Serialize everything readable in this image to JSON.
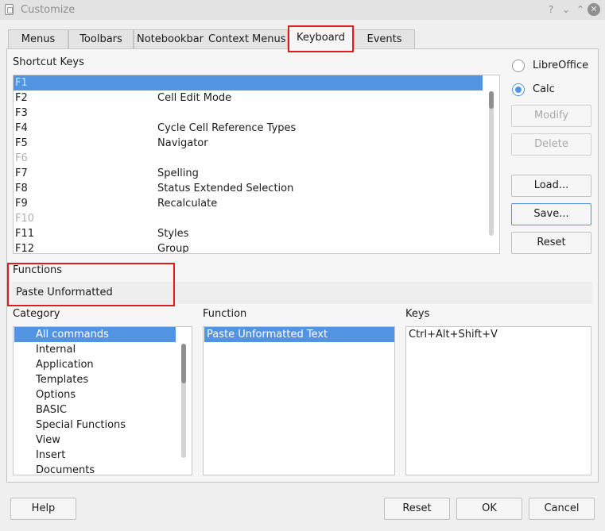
{
  "window": {
    "title": "Customize",
    "controls": [
      "?",
      "⌄",
      "⌃",
      "✕"
    ]
  },
  "tabs": [
    {
      "label": "Menus"
    },
    {
      "label": "Toolbars"
    },
    {
      "label": "Notebookbar"
    },
    {
      "label": "Context Menus"
    },
    {
      "label": "Keyboard",
      "active": true
    },
    {
      "label": "Events"
    }
  ],
  "shortcut_keys": {
    "label": "Shortcut Keys",
    "rows": [
      {
        "key": "F1",
        "function": ""
      },
      {
        "key": "F2",
        "function": "Cell Edit Mode"
      },
      {
        "key": "F3",
        "function": ""
      },
      {
        "key": "F4",
        "function": "Cycle Cell Reference Types"
      },
      {
        "key": "F5",
        "function": "Navigator"
      },
      {
        "key": "F6",
        "function": ""
      },
      {
        "key": "F7",
        "function": "Spelling"
      },
      {
        "key": "F8",
        "function": "Status Extended Selection"
      },
      {
        "key": "F9",
        "function": "Recalculate"
      },
      {
        "key": "F10",
        "function": ""
      },
      {
        "key": "F11",
        "function": "Styles"
      },
      {
        "key": "F12",
        "function": "Group"
      }
    ]
  },
  "scope": {
    "options": [
      {
        "label": "LibreOffice",
        "checked": false
      },
      {
        "label": "Calc",
        "checked": true
      }
    ]
  },
  "side_buttons": [
    {
      "label": "Modify",
      "enabled": false
    },
    {
      "label": "Delete",
      "enabled": false
    },
    {
      "label": "Load...",
      "enabled": true
    },
    {
      "label": "Save...",
      "enabled": true
    },
    {
      "label": "Reset",
      "enabled": true
    }
  ],
  "functions_section": {
    "label": "Functions",
    "search_value": "Paste Unformatted"
  },
  "category": {
    "label": "Category",
    "items": [
      "All commands",
      "Internal",
      "Application",
      "Templates",
      "Options",
      "BASIC",
      "Special Functions",
      "View",
      "Insert",
      "Documents"
    ],
    "selected": "All commands"
  },
  "function_list": {
    "label": "Function",
    "items": [
      "Paste Unformatted Text"
    ],
    "selected": "Paste Unformatted Text"
  },
  "keys_list": {
    "label": "Keys",
    "items": [
      "Ctrl+Alt+Shift+V"
    ]
  },
  "footer": {
    "help": "Help",
    "reset": "Reset",
    "ok": "OK",
    "cancel": "Cancel"
  },
  "colors": {
    "selection": "#5294e2",
    "highlight_box": "#e01b1b",
    "background": "#efefef"
  }
}
